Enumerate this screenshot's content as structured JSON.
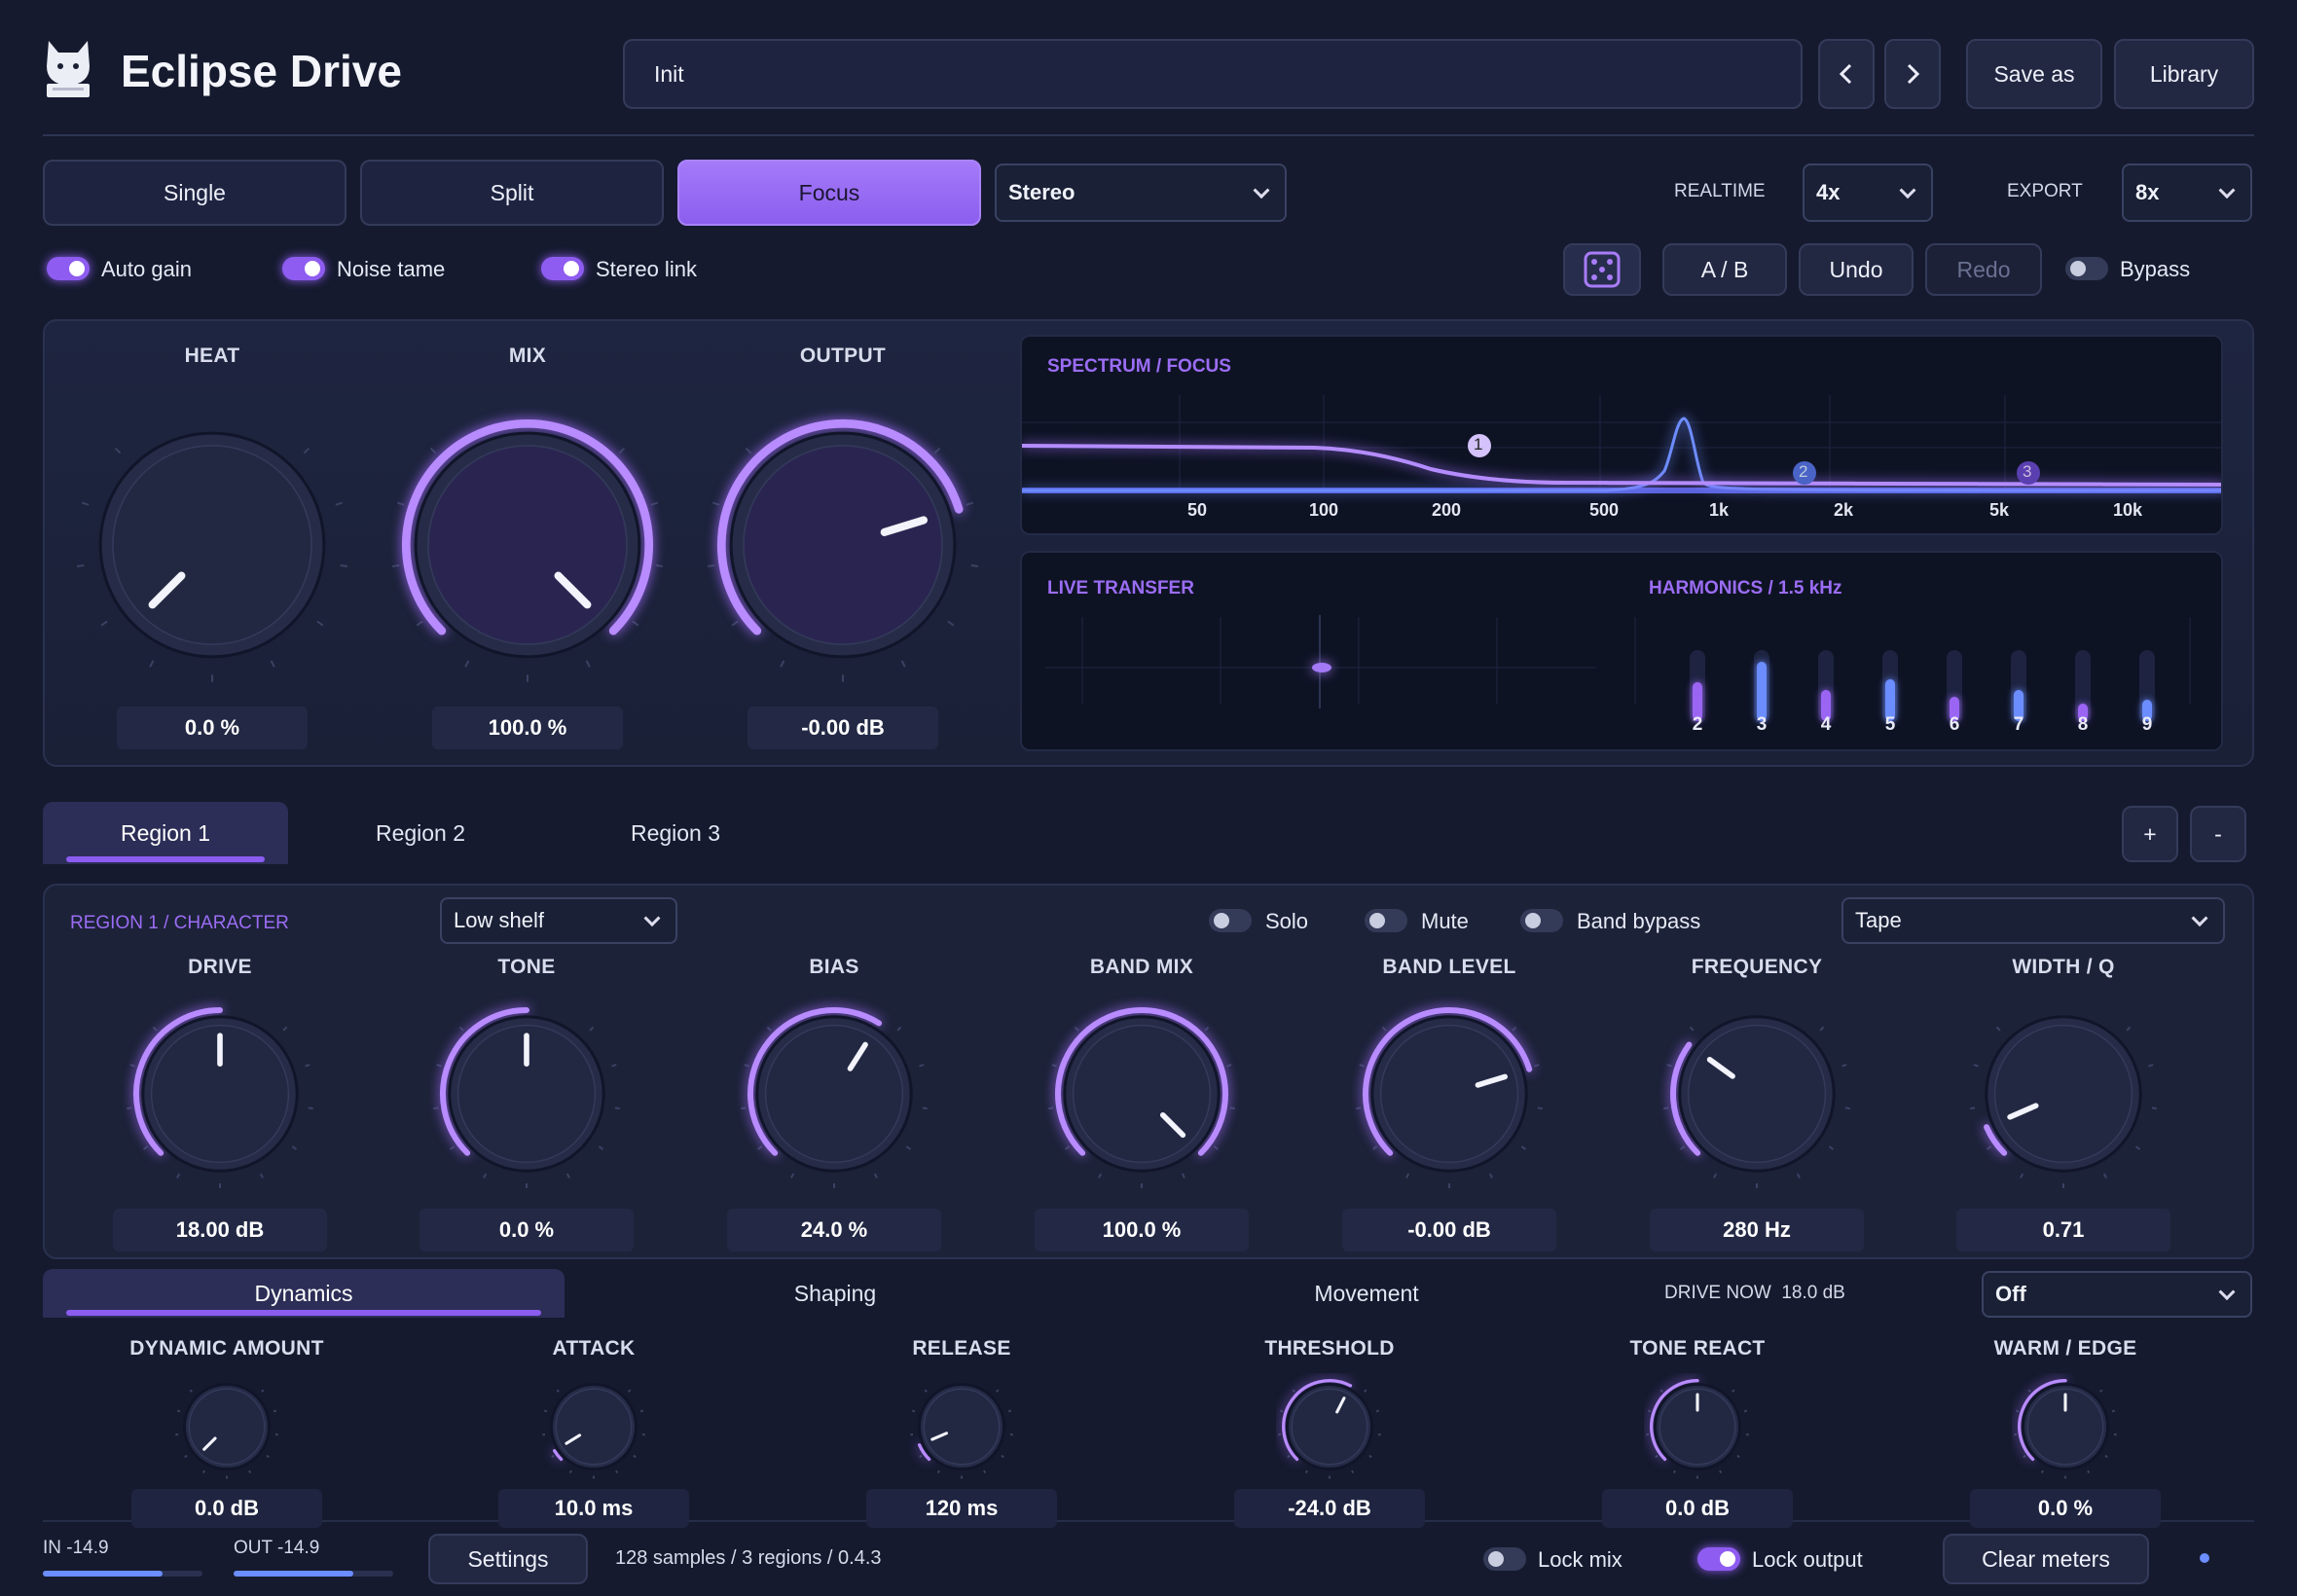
{
  "app": {
    "title": "Eclipse Drive",
    "logo_icon": "cat-icon"
  },
  "preset": {
    "name": "Init",
    "prev_label": "‹",
    "next_label": "›",
    "save_as": "Save as",
    "library": "Library"
  },
  "modes": {
    "single": "Single",
    "split": "Split",
    "focus": "Focus",
    "active": "Focus",
    "stereo": "Stereo"
  },
  "oversampling": {
    "realtime_label": "REALTIME",
    "realtime_value": "4x",
    "export_label": "EXPORT",
    "export_value": "8x"
  },
  "toggles": {
    "auto_gain": "Auto gain",
    "noise_tame": "Noise tame",
    "stereo_link": "Stereo link",
    "bypass": "Bypass"
  },
  "actions": {
    "ab": "A / B",
    "undo": "Undo",
    "redo": "Redo",
    "random_icon": "dice-icon"
  },
  "main_knobs": [
    {
      "label": "HEAT",
      "value": "0.0 %",
      "level": 0.0
    },
    {
      "label": "MIX",
      "value": "100.0 %",
      "level": 1.0
    },
    {
      "label": "OUTPUT",
      "value": "-0.00 dB",
      "level": 0.77
    }
  ],
  "spectrum": {
    "title": "SPECTRUM / FOCUS",
    "freq_labels": [
      "50",
      "100",
      "200",
      "500",
      "1k",
      "2k",
      "5k",
      "10k"
    ],
    "nodes": [
      "1",
      "2",
      "3"
    ]
  },
  "transfer": {
    "title": "LIVE TRANSFER"
  },
  "harmonics": {
    "title": "HARMONICS / 1.5 kHz",
    "labels": [
      "2",
      "3",
      "4",
      "5",
      "6",
      "7",
      "8",
      "9"
    ],
    "levels": [
      0.55,
      0.85,
      0.45,
      0.6,
      0.35,
      0.45,
      0.25,
      0.3
    ]
  },
  "regions": {
    "tabs": [
      "Region 1",
      "Region 2",
      "Region 3"
    ],
    "active": "Region 1",
    "add": "+",
    "remove": "-"
  },
  "region": {
    "title": "REGION 1 / CHARACTER",
    "filter_type": "Low shelf",
    "solo": "Solo",
    "mute": "Mute",
    "band_bypass": "Band bypass",
    "model": "Tape",
    "knobs": [
      {
        "label": "DRIVE",
        "value": "18.00 dB",
        "level": 0.5
      },
      {
        "label": "TONE",
        "value": "0.0 %",
        "level": 0.5
      },
      {
        "label": "BIAS",
        "value": "24.0 %",
        "level": 0.62
      },
      {
        "label": "BAND MIX",
        "value": "100.0 %",
        "level": 1.0
      },
      {
        "label": "BAND LEVEL",
        "value": "-0.00 dB",
        "level": 0.77
      },
      {
        "label": "FREQUENCY",
        "value": "280 Hz",
        "level": 0.3
      },
      {
        "label": "WIDTH / Q",
        "value": "0.71",
        "level": 0.08
      }
    ]
  },
  "dyn_tabs": {
    "tabs": [
      "Dynamics",
      "Shaping",
      "Movement"
    ],
    "active": "Dynamics",
    "drive_now_label": "DRIVE NOW",
    "drive_now_value": "18.0 dB",
    "mode": "Off"
  },
  "dyn_knobs": [
    {
      "label": "DYNAMIC AMOUNT",
      "value": "0.0 dB",
      "level": 0.0
    },
    {
      "label": "ATTACK",
      "value": "10.0 ms",
      "level": 0.05
    },
    {
      "label": "RELEASE",
      "value": "120 ms",
      "level": 0.08
    },
    {
      "label": "THRESHOLD",
      "value": "-24.0 dB",
      "level": 0.6
    },
    {
      "label": "TONE REACT",
      "value": "0.0 dB",
      "level": 0.5
    },
    {
      "label": "WARM / EDGE",
      "value": "0.0 %",
      "level": 0.5
    }
  ],
  "footer": {
    "in_label": "IN -14.9",
    "out_label": "OUT -14.9",
    "in_level": 0.75,
    "out_level": 0.75,
    "settings": "Settings",
    "info": "128 samples / 3 regions / 0.4.3",
    "lock_mix": "Lock mix",
    "lock_output": "Lock output",
    "clear_meters": "Clear meters"
  }
}
